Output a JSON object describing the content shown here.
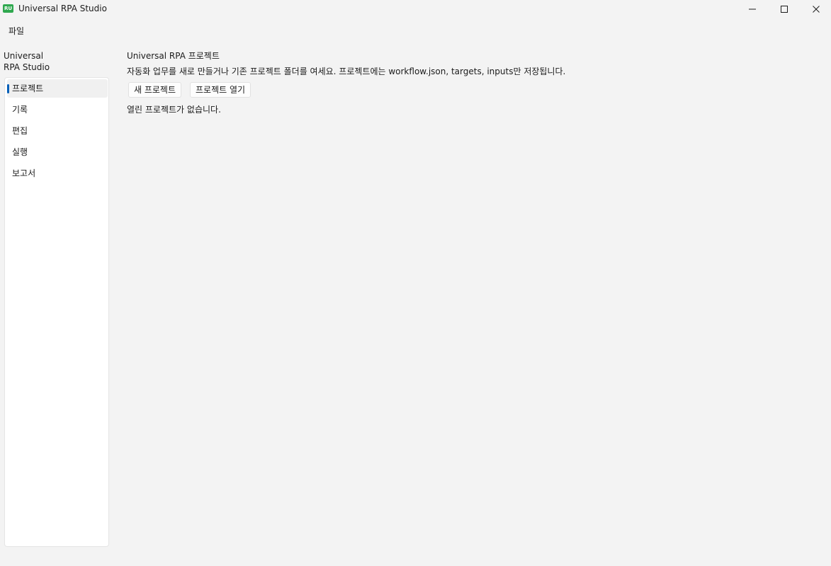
{
  "window": {
    "title": "Universal RPA Studio",
    "app_icon": "app-logo-icon",
    "app_icon_text": "RU",
    "controls": [
      "minimize-icon",
      "maximize-icon",
      "close-icon"
    ]
  },
  "menubar": {
    "items": [
      {
        "label": "파일"
      }
    ]
  },
  "brand": {
    "line1": "Universal",
    "line2": "RPA Studio"
  },
  "sidebar": {
    "active_index": 0,
    "items": [
      {
        "label": "프로젝트"
      },
      {
        "label": "기록"
      },
      {
        "label": "편집"
      },
      {
        "label": "실행"
      },
      {
        "label": "보고서"
      }
    ]
  },
  "main": {
    "title": "Universal RPA 프로젝트",
    "description": "자동화 업무를 새로 만들거나 기존 프로젝트 폴더를 여세요. 프로젝트에는 workflow.json, targets, inputs만 저장됩니다.",
    "buttons": {
      "new_project": "새 프로젝트",
      "open_project": "프로젝트 열기"
    },
    "status": "열린 프로젝트가 없습니다."
  },
  "colors": {
    "background": "#f3f3f3",
    "accent": "#005fb8",
    "app_icon": "#2fa84f"
  }
}
